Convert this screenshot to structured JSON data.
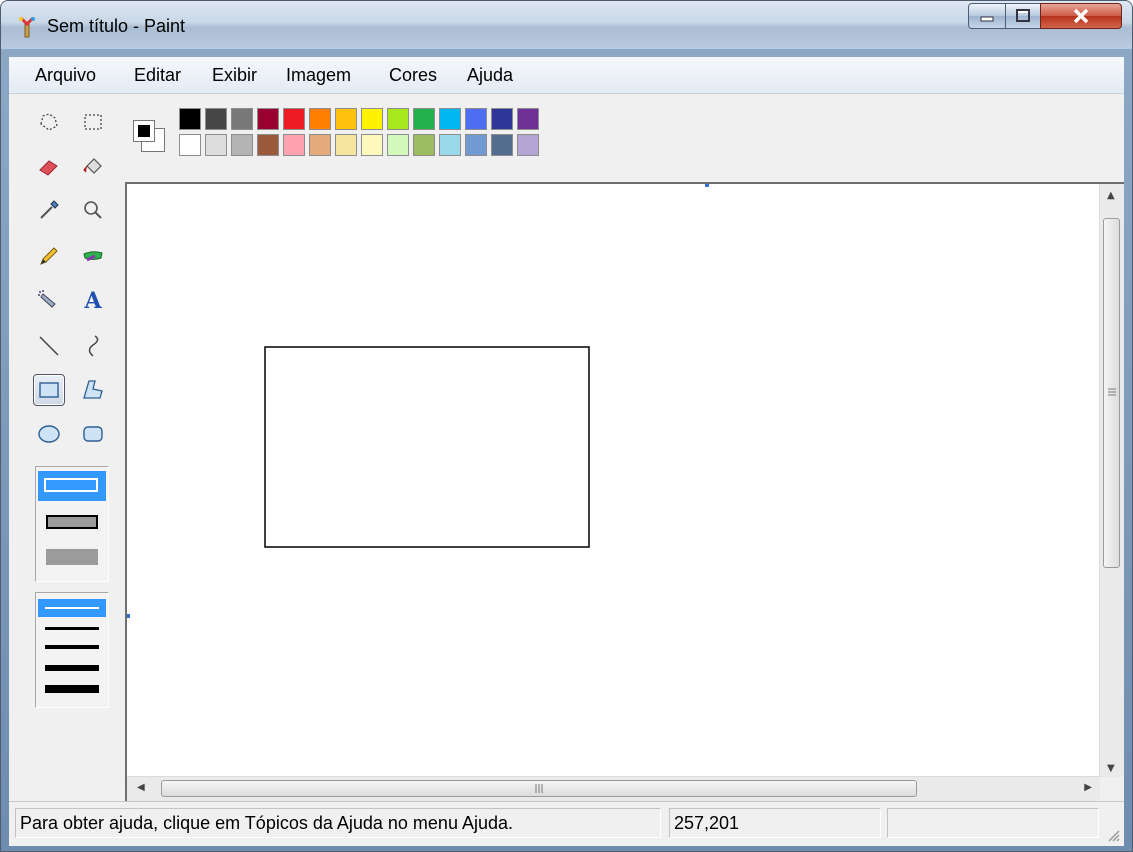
{
  "window": {
    "title": "Sem título - Paint",
    "title_icon": "paint-app-icon",
    "controls": [
      "minimize-icon",
      "maximize-icon",
      "close-icon"
    ]
  },
  "menu": [
    {
      "label": "Arquivo"
    },
    {
      "label": "Editar"
    },
    {
      "label": "Exibir"
    },
    {
      "label": "Imagem"
    },
    {
      "label": "Cores"
    },
    {
      "label": "Ajuda"
    }
  ],
  "tools": {
    "items": [
      "free-form-select",
      "rectangle-select",
      "eraser",
      "fill-with-color",
      "pick-color",
      "magnifier",
      "pencil",
      "brush",
      "airbrush",
      "text",
      "line",
      "curve",
      "rectangle",
      "polygon",
      "ellipse",
      "rounded-rectangle"
    ],
    "selected": "rectangle"
  },
  "palette": {
    "foreground": "#000000",
    "background": "#ffffff",
    "row1": [
      "#000000",
      "#464646",
      "#787878",
      "#990030",
      "#ed1c24",
      "#ff7e00",
      "#ffc20e",
      "#fff200",
      "#a8e61d",
      "#22b14c",
      "#00b7ef",
      "#4d6df3",
      "#2f3699",
      "#6f3198"
    ],
    "row2": [
      "#ffffff",
      "#dcdcdc",
      "#b4b4b4",
      "#9c5a3c",
      "#ffa3b1",
      "#e5aa7a",
      "#f5e49c",
      "#fff9bd",
      "#d3f9bc",
      "#9dbb61",
      "#99d9ea",
      "#709ad1",
      "#546d8e",
      "#b5a5d5"
    ]
  },
  "status": {
    "help": "Para obter ajuda, clique em Tópicos da Ajuda no menu Ajuda.",
    "coords": "257,201",
    "size": ""
  }
}
